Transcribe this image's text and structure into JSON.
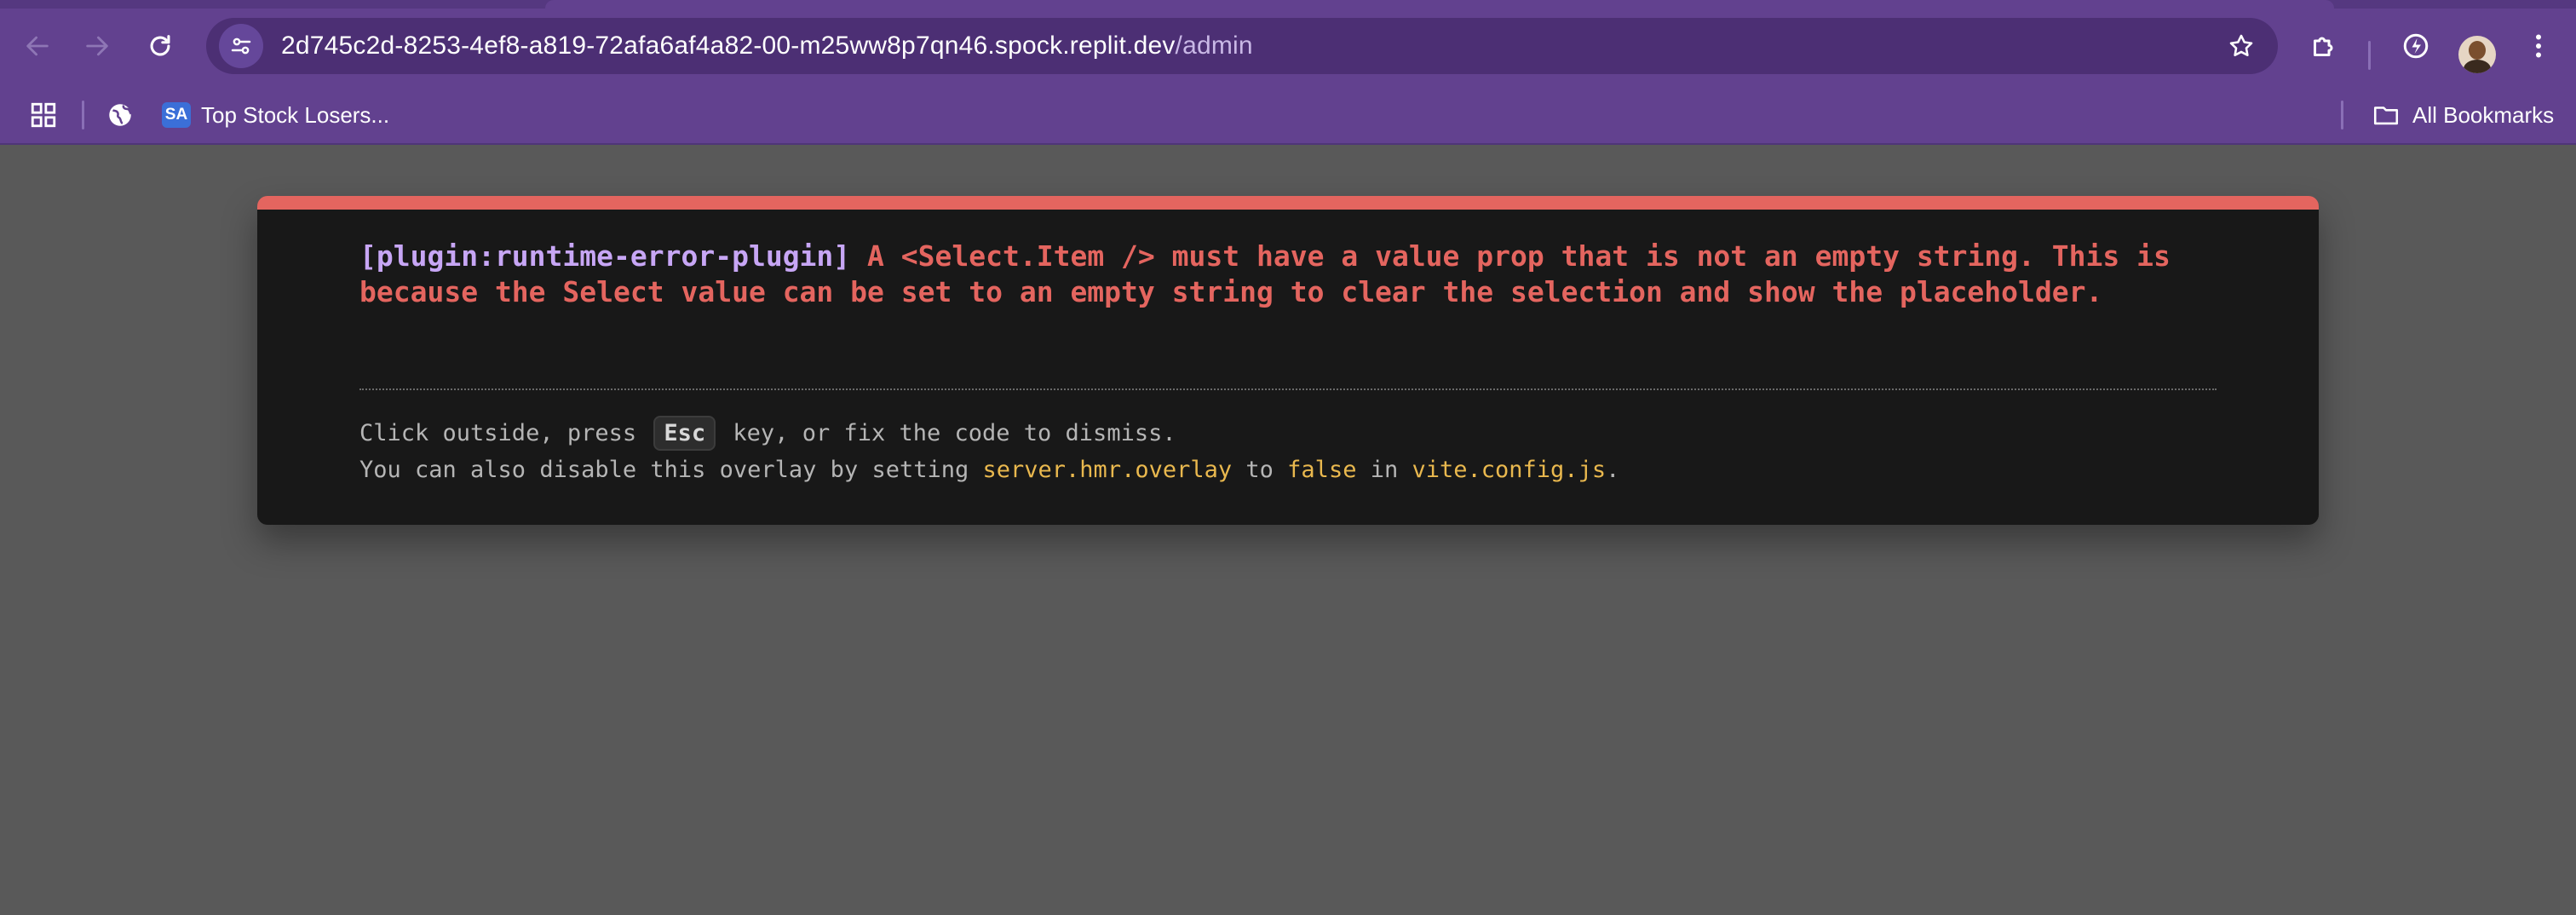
{
  "browser": {
    "url_host": "2d745c2d-8253-4ef8-a819-72afa6af4a82-00-m25ww8p7qn46.spock.replit.dev",
    "url_path": "/admin",
    "bookmarks": [
      {
        "label": "",
        "icon": "globe-icon"
      },
      {
        "label": "Top Stock Losers...",
        "icon": "sa-icon",
        "icon_text": "SA"
      }
    ],
    "all_bookmarks_label": "All Bookmarks"
  },
  "overlay": {
    "plugin": "[plugin:runtime-error-plugin]",
    "message": "A <Select.Item /> must have a value prop that is not an empty string. This is because the Select value can be set to an empty string to clear the selection and show the placeholder.",
    "tip_line1_prefix": "Click outside, press",
    "tip_key": "Esc",
    "tip_line1_suffix": "key, or fix the code to dismiss.",
    "tip_line2_prefix": "You can also disable this overlay by setting",
    "tip_code1": "server.hmr.overlay",
    "tip_line2_mid1": "to",
    "tip_code2": "false",
    "tip_line2_mid2": "in",
    "tip_code3": "vite.config.js",
    "tip_line2_end": "."
  },
  "colors": {
    "chrome": "#62418f",
    "page_bg": "#595959",
    "error_red": "#e4655f",
    "plugin_purple": "#c7a6f5",
    "code_yellow": "#e9b84e"
  }
}
